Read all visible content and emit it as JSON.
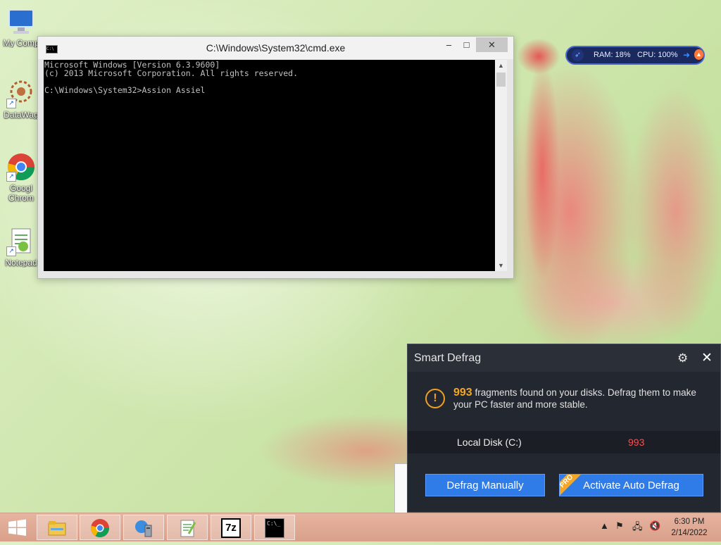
{
  "desktop": {
    "icons": [
      {
        "label": "My Comp",
        "icon": "computer-icon"
      },
      {
        "label": "DataWag",
        "icon": "datawag-icon"
      },
      {
        "label": "Googl Chrom",
        "icon": "chrome-icon"
      },
      {
        "label": "Notepad",
        "icon": "notepad-icon"
      }
    ]
  },
  "cmd": {
    "title": "C:\\Windows\\System32\\cmd.exe",
    "app_icon_text": "C:\\",
    "minimize": "–",
    "maximize": "□",
    "close": "✕",
    "lines": [
      "Microsoft Windows [Version 6.3.9600]",
      "(c) 2013 Microsoft Corporation. All rights reserved.",
      "",
      "C:\\Windows\\System32>Assion Assiel"
    ]
  },
  "monitor": {
    "ram": "RAM: 18%",
    "cpu": "CPU: 100%",
    "colors": {
      "bg": "#1a2a5e",
      "border": "#4d6ad0"
    }
  },
  "defrag": {
    "title": "Smart Defrag",
    "fragments": "993",
    "message": "fragments found on your disks. Defrag them to make your PC faster and more stable.",
    "disk_name": "Local Disk (C:)",
    "disk_count": "993",
    "btn_manual": "Defrag Manually",
    "btn_auto": "Activate Auto Defrag",
    "pro_badge": "PRO",
    "colors": {
      "accent": "#2f7be8",
      "warning": "#f5a623",
      "count": "#ff4d4d"
    }
  },
  "taskbar": {
    "items": [
      "file-explorer-icon",
      "chrome-icon",
      "network-tool-icon",
      "notepad-plus-plus-icon",
      "7zip-icon",
      "cmd-icon"
    ],
    "sevenzip_label": "7z",
    "cmd_label": "C:\\_",
    "time": "6:30 PM",
    "date": "2/14/2022"
  }
}
